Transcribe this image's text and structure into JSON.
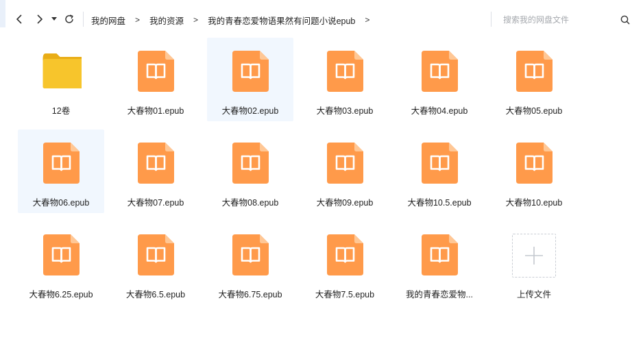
{
  "toolbar": {
    "back_icon": "chevron-left-icon",
    "forward_icon": "chevron-right-icon",
    "dropdown_icon": "caret-down-icon",
    "refresh_icon": "refresh-icon"
  },
  "breadcrumb": {
    "items": [
      "我的网盘",
      "我的资源",
      "我的青春恋爱物语果然有问题小说epub"
    ],
    "separator": ">"
  },
  "search": {
    "placeholder": "搜索我的网盘文件",
    "icon": "search-icon"
  },
  "colors": {
    "folder": "#f7c52c",
    "folder_tab": "#e9ad17",
    "epub": "#ff9a4a",
    "epub_fold": "#ffc795",
    "selected_bg": "#f1f7fe"
  },
  "files": {
    "folder": {
      "name": "12卷",
      "icon": "folder-icon"
    },
    "epubs": [
      {
        "name": "大春物01.epub",
        "selected": false
      },
      {
        "name": "大春物02.epub",
        "selected": true
      },
      {
        "name": "大春物03.epub",
        "selected": false
      },
      {
        "name": "大春物04.epub",
        "selected": false
      },
      {
        "name": "大春物05.epub",
        "selected": false
      },
      {
        "name": "大春物06.epub",
        "selected": true
      },
      {
        "name": "大春物07.epub",
        "selected": false
      },
      {
        "name": "大春物08.epub",
        "selected": false
      },
      {
        "name": "大春物09.epub",
        "selected": false
      },
      {
        "name": "大春物10.5.epub",
        "selected": false
      },
      {
        "name": "大春物10.epub",
        "selected": false
      },
      {
        "name": "大春物6.25.epub",
        "selected": false
      },
      {
        "name": "大春物6.5.epub",
        "selected": false
      },
      {
        "name": "大春物6.75.epub",
        "selected": false
      },
      {
        "name": "大春物7.5.epub",
        "selected": false
      },
      {
        "name": "我的青春恋爱物...",
        "selected": false
      }
    ],
    "epub_icon": "epub-book-icon"
  },
  "upload": {
    "label": "上传文件",
    "icon": "plus-icon"
  }
}
